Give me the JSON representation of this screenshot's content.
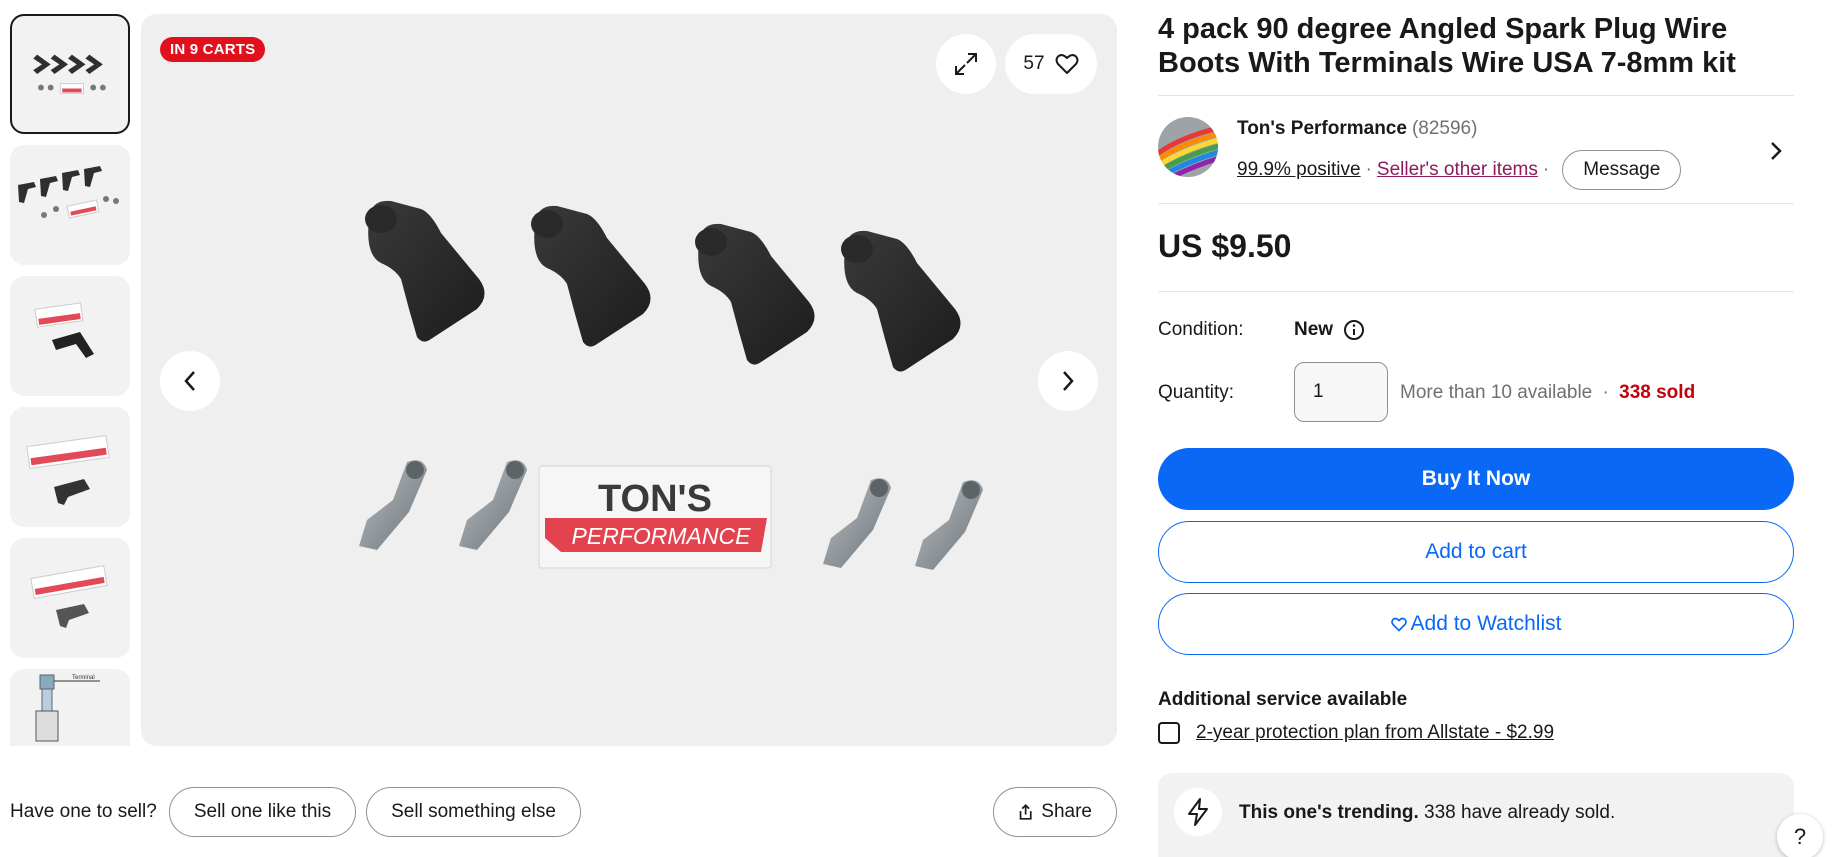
{
  "listing": {
    "title": "4 pack 90 degree Angled Spark Plug Wire Boots With Terminals Wire USA 7-8mm kit",
    "in_carts_badge": "IN 9 CARTS",
    "watch_count": "57",
    "price": "US $9.50"
  },
  "gallery": {
    "thumbnails": [
      "product-overview",
      "boots-and-terminals",
      "single-boot-with-logo",
      "boot-with-card",
      "boot-with-card-alt",
      "spark-plug-diagram"
    ],
    "selected_index": 0,
    "logo_text_line1": "TON'S",
    "logo_text_line2": "PERFORMANCE",
    "diagram_label": "Terminal"
  },
  "seller": {
    "name": "Ton's Performance",
    "feedback_count": "(82596)",
    "positive": "99.9% positive",
    "other_items": "Seller's other items",
    "message_label": "Message"
  },
  "condition": {
    "label": "Condition:",
    "value": "New"
  },
  "quantity": {
    "label": "Quantity:",
    "value": "1",
    "available": "More than 10 available",
    "sold": "338 sold"
  },
  "actions": {
    "buy_now": "Buy It Now",
    "add_to_cart": "Add to cart",
    "add_to_watchlist": "Add to Watchlist"
  },
  "additional_service": {
    "title": "Additional service available",
    "protection": "2-year protection plan from Allstate - $2.99"
  },
  "trending": {
    "bold": "This one's trending.",
    "text": "338 have already sold."
  },
  "sell": {
    "label": "Have one to sell?",
    "sell_like": "Sell one like this",
    "sell_else": "Sell something else"
  },
  "share_label": "Share",
  "help_label": "?",
  "colors": {
    "primary": "#0968f6",
    "badge": "#e0101c",
    "sold": "#c4000a",
    "seller_link": "#8d1b5e"
  }
}
